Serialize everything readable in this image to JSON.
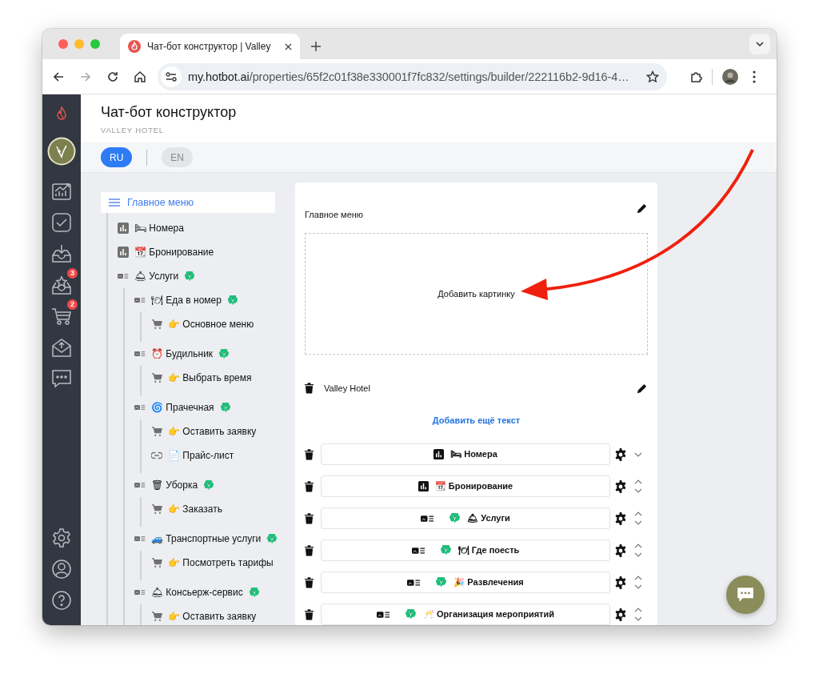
{
  "browser": {
    "tab_title": "Чат-бот конструктор | Valley",
    "url_host": "my.hotbot.ai",
    "url_path": "/properties/65f2c01f38e330001f7fc832/settings/builder/222116b2-9d16-4…"
  },
  "nav": [
    {
      "kind": "analytics"
    },
    {
      "kind": "tasks"
    },
    {
      "kind": "inbox"
    },
    {
      "kind": "reviews",
      "badge": "3"
    },
    {
      "kind": "orders",
      "badge": "2"
    },
    {
      "kind": "mail"
    },
    {
      "kind": "chat"
    }
  ],
  "nav_bottom": [
    {
      "kind": "settings"
    },
    {
      "kind": "profile"
    },
    {
      "kind": "help"
    }
  ],
  "header": {
    "title": "Чат-бот конструктор",
    "subtitle": "VALLEY HOTEL"
  },
  "languages": [
    {
      "label": "RU",
      "selected": true
    },
    {
      "label": "EN",
      "selected": false
    }
  ],
  "tree": {
    "label": "Главное меню",
    "selected": true,
    "children": [
      {
        "kind": "chart",
        "label": "🛏 Номера",
        "ai": false
      },
      {
        "kind": "chart",
        "label": "📆 Бронирование",
        "ai": false
      },
      {
        "kind": "menu",
        "label": "🛎 Услуги",
        "ai": true,
        "children": [
          {
            "kind": "menu",
            "label": "🍽 Еда в номер",
            "ai": true,
            "children": [
              {
                "kind": "cart",
                "label": "👉 Основное меню",
                "ai": false
              }
            ]
          },
          {
            "kind": "menu",
            "label": "⏰ Будильник",
            "ai": true,
            "children": [
              {
                "kind": "cart",
                "label": "👉 Выбрать время",
                "ai": false
              }
            ]
          },
          {
            "kind": "menu",
            "label": "🌀 Прачечная",
            "ai": true,
            "children": [
              {
                "kind": "cart",
                "label": "👉 Оставить заявку",
                "ai": false
              },
              {
                "kind": "link",
                "label": "📄 Прайс-лист",
                "ai": false
              }
            ]
          },
          {
            "kind": "menu",
            "label": "🗑 Уборка",
            "ai": true,
            "children": [
              {
                "kind": "cart",
                "label": "👉 Заказать",
                "ai": false
              }
            ]
          },
          {
            "kind": "menu",
            "label": "🚙 Транспортные услуги",
            "ai": true,
            "children": [
              {
                "kind": "cart",
                "label": "👉 Посмотреть тарифы",
                "ai": false
              }
            ]
          },
          {
            "kind": "menu",
            "label": "🛎 Консьерж-сервис",
            "ai": true,
            "children": [
              {
                "kind": "cart",
                "label": "👉 Оставить заявку",
                "ai": false
              }
            ]
          }
        ]
      }
    ]
  },
  "card": {
    "title": "Главное меню",
    "image_placeholder": "Добавить картинку",
    "texts": [
      "Valley Hotel"
    ],
    "add_text_link": "Добавить ещё текст",
    "buttons": [
      {
        "kind": "chart",
        "label": "🛏 Номера",
        "ai": false,
        "move_up": false,
        "move_down": true
      },
      {
        "kind": "chart",
        "label": "📆 Бронирование",
        "ai": false,
        "move_up": true,
        "move_down": true
      },
      {
        "kind": "menu",
        "label": "🛎 Услуги",
        "ai": true,
        "move_up": true,
        "move_down": true
      },
      {
        "kind": "menu",
        "label": "🍽 Где поесть",
        "ai": true,
        "move_up": true,
        "move_down": true
      },
      {
        "kind": "menu",
        "label": "🎉 Развлечения",
        "ai": true,
        "move_up": true,
        "move_down": true
      },
      {
        "kind": "menu",
        "label": "🥂 Организация мероприятий",
        "ai": true,
        "move_up": true,
        "move_down": true
      }
    ]
  }
}
